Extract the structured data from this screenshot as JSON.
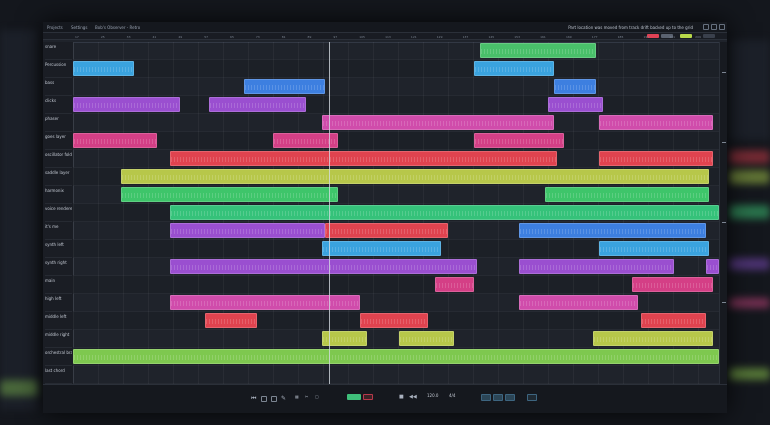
{
  "titlebar": {
    "tabs": [
      "Projects",
      "Settings",
      "Bob's Observer - Retro"
    ],
    "status": "Part location was moved from track drift backed up to the grid",
    "colors": {
      "bg": "#15181e",
      "text": "#9aa3b2"
    }
  },
  "toolbar": {
    "flags": [
      {
        "color": "#e04255"
      },
      {
        "color": "#5a6270"
      },
      {
        "color": "#b8d94a"
      },
      {
        "color": "#3a404c"
      }
    ]
  },
  "ruler": {
    "marks": [
      "17",
      "25",
      "33",
      "41",
      "49",
      "57",
      "65",
      "73",
      "81",
      "89",
      "97",
      "105",
      "113",
      "121",
      "129",
      "137",
      "145",
      "153",
      "161",
      "169",
      "177",
      "185",
      "193",
      "201",
      "209"
    ]
  },
  "tracks": [
    {
      "name": "snare",
      "clips": [
        {
          "start": 0.63,
          "end": 0.81,
          "color": "#49c06a",
          "label": ""
        }
      ]
    },
    {
      "name": "Percussion",
      "clips": [
        {
          "start": 0.0,
          "end": 0.095,
          "color": "#3aa3df",
          "label": ""
        },
        {
          "start": 0.62,
          "end": 0.745,
          "color": "#3aa3df",
          "label": ""
        }
      ]
    },
    {
      "name": "bass",
      "clips": [
        {
          "start": 0.265,
          "end": 0.39,
          "color": "#3d7fe0",
          "label": ""
        },
        {
          "start": 0.745,
          "end": 0.81,
          "color": "#3d7fe0",
          "label": ""
        }
      ]
    },
    {
      "name": "clicks",
      "clips": [
        {
          "start": 0.0,
          "end": 0.165,
          "color": "#9a4fd0",
          "label": ""
        },
        {
          "start": 0.21,
          "end": 0.36,
          "color": "#9a4fd0",
          "label": ""
        },
        {
          "start": 0.735,
          "end": 0.82,
          "color": "#9a4fd0",
          "label": ""
        }
      ]
    },
    {
      "name": "phaser",
      "clips": [
        {
          "start": 0.385,
          "end": 0.745,
          "color": "#d04cab",
          "label": ""
        },
        {
          "start": 0.815,
          "end": 0.99,
          "color": "#d04cab",
          "label": ""
        }
      ]
    },
    {
      "name": "goes layer",
      "clips": [
        {
          "start": 0.0,
          "end": 0.13,
          "color": "#d43f86",
          "label": ""
        },
        {
          "start": 0.31,
          "end": 0.41,
          "color": "#d43f86",
          "label": ""
        },
        {
          "start": 0.62,
          "end": 0.76,
          "color": "#d43f86",
          "label": ""
        }
      ]
    },
    {
      "name": "oscillator fold",
      "clips": [
        {
          "start": 0.15,
          "end": 0.75,
          "color": "#e0434f",
          "label": ""
        },
        {
          "start": 0.815,
          "end": 0.99,
          "color": "#e0434f",
          "label": ""
        }
      ]
    },
    {
      "name": "saddle layer",
      "clips": [
        {
          "start": 0.075,
          "end": 0.985,
          "color": "#b7c74a",
          "label": ""
        }
      ]
    },
    {
      "name": "harmonix",
      "clips": [
        {
          "start": 0.075,
          "end": 0.41,
          "color": "#3ec56a",
          "label": ""
        },
        {
          "start": 0.73,
          "end": 0.985,
          "color": "#3ec56a",
          "label": ""
        }
      ]
    },
    {
      "name": "voice rendered",
      "clips": [
        {
          "start": 0.15,
          "end": 1.0,
          "color": "#35c27a",
          "label": ""
        }
      ]
    },
    {
      "name": "it's me",
      "clips": [
        {
          "start": 0.15,
          "end": 0.39,
          "color": "#9a4fd0",
          "label": ""
        },
        {
          "start": 0.39,
          "end": 0.58,
          "color": "#e0434f",
          "label": ""
        },
        {
          "start": 0.69,
          "end": 0.98,
          "color": "#3d7fe0",
          "label": ""
        }
      ]
    },
    {
      "name": "synth left",
      "clips": [
        {
          "start": 0.385,
          "end": 0.57,
          "color": "#3aa3df",
          "label": ""
        },
        {
          "start": 0.815,
          "end": 0.985,
          "color": "#3aa3df",
          "label": ""
        }
      ]
    },
    {
      "name": "synth right",
      "clips": [
        {
          "start": 0.15,
          "end": 0.625,
          "color": "#9a4fd0",
          "label": ""
        },
        {
          "start": 0.69,
          "end": 0.93,
          "color": "#9a4fd0",
          "label": ""
        },
        {
          "start": 0.98,
          "end": 1.0,
          "color": "#9a4fd0",
          "label": ""
        }
      ]
    },
    {
      "name": "main",
      "clips": [
        {
          "start": 0.56,
          "end": 0.62,
          "color": "#d43f86",
          "label": ""
        },
        {
          "start": 0.865,
          "end": 0.99,
          "color": "#d43f86",
          "label": ""
        }
      ]
    },
    {
      "name": "high left",
      "clips": [
        {
          "start": 0.15,
          "end": 0.445,
          "color": "#d04cab",
          "label": ""
        },
        {
          "start": 0.69,
          "end": 0.875,
          "color": "#d04cab",
          "label": ""
        }
      ]
    },
    {
      "name": "middle left",
      "clips": [
        {
          "start": 0.205,
          "end": 0.285,
          "color": "#e0434f",
          "label": ""
        },
        {
          "start": 0.445,
          "end": 0.55,
          "color": "#e0434f",
          "label": ""
        },
        {
          "start": 0.88,
          "end": 0.98,
          "color": "#e0434f",
          "label": ""
        }
      ]
    },
    {
      "name": "middle right",
      "clips": [
        {
          "start": 0.385,
          "end": 0.455,
          "color": "#b7c74a",
          "label": ""
        },
        {
          "start": 0.505,
          "end": 0.59,
          "color": "#b7c74a",
          "label": ""
        },
        {
          "start": 0.805,
          "end": 0.99,
          "color": "#b7c74a",
          "label": ""
        }
      ]
    },
    {
      "name": "orchestral brass section",
      "clips": [
        {
          "start": 0.0,
          "end": 1.0,
          "color": "#7ec84f",
          "label": ""
        }
      ]
    },
    {
      "name": "last chord",
      "clips": []
    }
  ],
  "playhead": {
    "position": 0.397
  },
  "transport": {
    "tempo": "120.0",
    "signature": "4/4",
    "colors": {
      "play": "#3fbf7a",
      "record": "#b6394b"
    }
  }
}
